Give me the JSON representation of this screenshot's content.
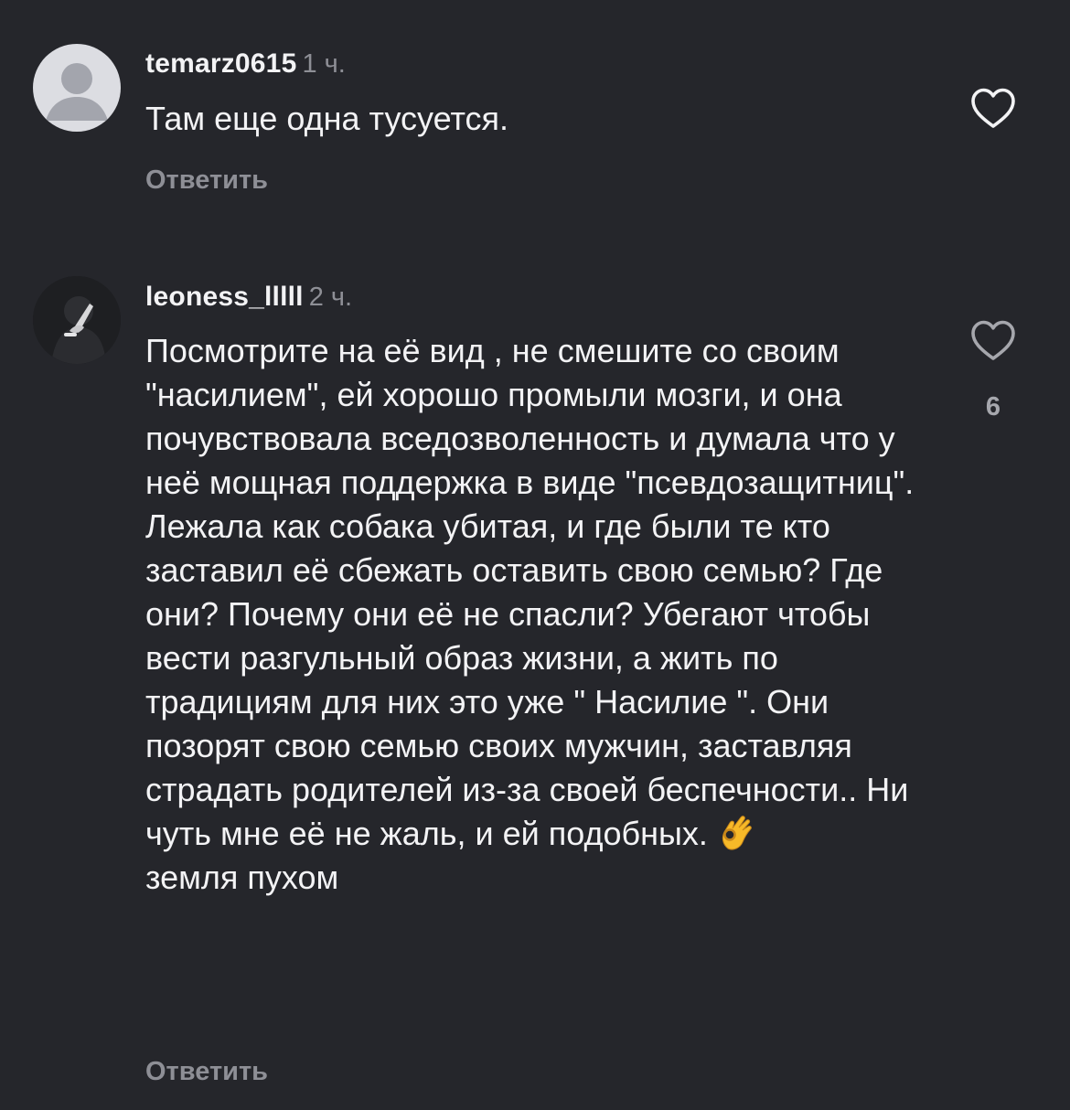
{
  "comments": [
    {
      "username": "temarz0615",
      "time": "1 ч.",
      "text": "Там еще одна тусуется.",
      "reply_label": "Ответить",
      "like_icon": "heart-outline-icon",
      "avatar": "default-avatar-icon"
    },
    {
      "username": "leoness_lllll",
      "time": "2 ч.",
      "text_before_emoji": "Посмотрите на её вид , не смешите со своим \"насилием\", ей хорошо промыли мозги, и она почувствовала вседозволенность и думала что у неё мощная поддержка в виде \"псевдозащитниц\". Лежала как собака убитая, и где были те кто заставил её сбежать оставить свою семью? Где они? Почему они её не спасли? Убегают чтобы вести разгульный образ жизни, а жить по традициям для них это уже \" Насилие \". Они позорят свою семью своих мужчин, заставляя страдать родителей из-за своей беспечности.. Ни чуть мне её не жаль, и ей подобных.",
      "emoji": "ok-hand-emoji",
      "text_after_emoji": "земля пухом",
      "reply_label": "Ответить",
      "like_icon": "heart-outline-icon",
      "like_count": "6",
      "avatar": "user-photo-avatar"
    }
  ],
  "colors": {
    "background": "#25262b",
    "primary_text": "#f3f3f5",
    "secondary_text": "#8e8f96"
  }
}
